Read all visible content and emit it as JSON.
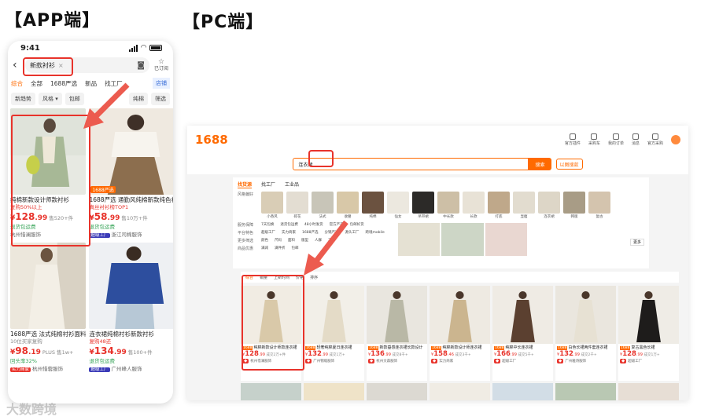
{
  "headings": {
    "app": "【APP端】",
    "pc": "【PC端】"
  },
  "app": {
    "time": "9:41",
    "search_value": "新款衬衫",
    "search_clear": "×",
    "subscribe_label": "已订阅",
    "tabs": [
      "综合",
      "全部",
      "1688严选",
      "新品",
      "找工厂",
      "店铺"
    ],
    "filters": [
      "新趋势",
      "风格",
      "包邮",
      "纯棉",
      "筛选"
    ],
    "products": [
      {
        "title": "纯棉新款设计师款衬衫",
        "sub": "复购50%以上",
        "price_int": "128",
        "price_dec": ".99",
        "sold": "售520+件",
        "promo": "退货包运费",
        "shop": "杭州惜澜服饰",
        "tag": "",
        "highlighted": true
      },
      {
        "title": "1688严选 通勤风纯棉新款纯色衬衫",
        "sub": "真丝衬衫榜TOP1",
        "price_int": "58",
        "price_dec": ".99",
        "sold": "售10万+件",
        "promo": "退货包运费",
        "shop": "浙江司棉服饰",
        "tag": "超级工厂",
        "highlighted": false
      },
      {
        "title": "1688严选 法式纯棉衬衫面料",
        "sub": "10位买家复购",
        "price_int": "98",
        "price_dec": ".19",
        "sold": "PLUS 售1w+",
        "promo": "回头率32%",
        "shop": "杭州惜蓉服饰",
        "tag": "实力商家",
        "highlighted": false
      },
      {
        "title": "连衣裙纯棉衬衫新款衬衫",
        "sub": "复购48还",
        "price_int": "134",
        "price_dec": ".99",
        "sold": "售100+件",
        "promo": "退货包运费",
        "shop": "广州峰人服饰",
        "tag": "超级工厂",
        "highlighted": false
      }
    ]
  },
  "pc": {
    "logo": "1688",
    "top_icons": [
      "官方插件",
      "采购车",
      "我的订单",
      "消息",
      "官方采购"
    ],
    "search_value": "连衣裙",
    "search_button": "搜索",
    "image_search": "以图搜款",
    "panel_tabs": [
      "找货源",
      "找工厂",
      "工业品"
    ],
    "style_label": "风格偏好",
    "styles": [
      "小香风",
      "碎花",
      "法式",
      "收腰",
      "纯棉",
      "仙女",
      "吊带裙",
      "中长款",
      "长款",
      "打底",
      "显瘦",
      "连衣裙",
      "韩版",
      "复古"
    ],
    "filter_rows": [
      {
        "label": "服务保障",
        "options": [
          "7天包换",
          "退货包运费",
          "48小时发货",
          "官方严选",
          "包邮好货"
        ]
      },
      {
        "label": "平台特色",
        "options": [
          "超级工厂",
          "实力商家",
          "1688严选",
          "分销严选",
          "源头工厂",
          "跨境mobile"
        ]
      },
      {
        "label": "更多筛选",
        "options": [
          "颜色",
          "尺码",
          "面料",
          "版型",
          "人群",
          "工艺"
        ]
      },
      {
        "label": "商品优惠",
        "options": [
          "满减",
          "满件折",
          "包邮"
        ]
      }
    ],
    "more_label": "更多",
    "sort": [
      "综合",
      "销量",
      "上新时间",
      "价格",
      "排序"
    ],
    "products": [
      {
        "title": "纯棉新款设计师款连衣裙",
        "price_int": "128",
        "price_dec": ".99",
        "sold": "成交2万+件",
        "shop": "杭州惜澜服饰"
      },
      {
        "title": "轻奢纯棉夏日连衣裙",
        "price_int": "132",
        "price_dec": ".99",
        "sold": "成交1万+",
        "shop": "广州锦缎服饰"
      },
      {
        "title": "新款垂感连衣裙长款设计",
        "price_int": "136",
        "price_dec": ".99",
        "sold": "成交8千+",
        "shop": "杭州文森服饰"
      },
      {
        "title": "纯棉新款设计师连衣裙",
        "price_int": "158",
        "price_dec": ".46",
        "sold": "成交3千+",
        "shop": "实力商家"
      },
      {
        "title": "纯棉中长连衣裙",
        "price_int": "166",
        "price_dec": ".99",
        "sold": "成交5千+",
        "shop": "超级工厂"
      },
      {
        "title": "白色长裙两件套连衣裙",
        "price_int": "132",
        "price_dec": ".99",
        "sold": "成交2千+",
        "shop": "广州雅诗服饰"
      },
      {
        "title": "复古黑色长裙",
        "price_int": "128",
        "price_dec": ".99",
        "sold": "成交1万+",
        "shop": "超级工厂"
      }
    ]
  },
  "watermark": "大数跨境"
}
